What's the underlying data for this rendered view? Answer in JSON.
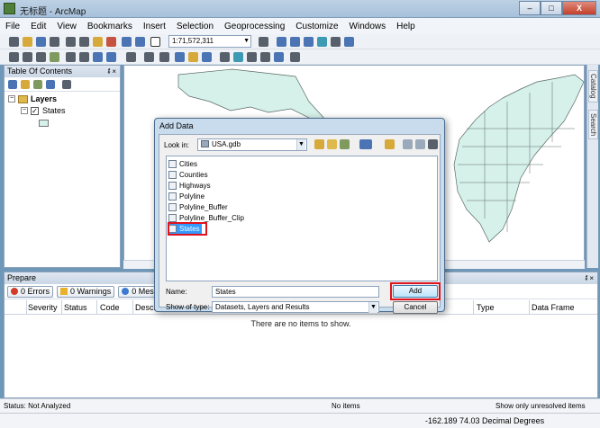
{
  "window": {
    "title": "无标题 - ArcMap",
    "buttons": {
      "minimize": "–",
      "maximize": "□",
      "close": "X"
    }
  },
  "menubar": {
    "items": [
      "File",
      "Edit",
      "View",
      "Bookmarks",
      "Insert",
      "Selection",
      "Geoprocessing",
      "Customize",
      "Windows",
      "Help"
    ]
  },
  "toolbar": {
    "scale": "1:71,572,311",
    "icons": [
      "new-document-icon",
      "open-icon",
      "save-icon",
      "print-icon",
      "cut-icon",
      "copy-icon",
      "paste-icon",
      "delete-icon",
      "undo-icon",
      "redo-icon",
      "add-data-icon",
      "zoom-in-icon",
      "zoom-out-icon",
      "pan-icon",
      "full-extent-icon",
      "identify-icon",
      "find-icon",
      "measure-icon"
    ]
  },
  "toc": {
    "title": "Table Of Contents",
    "pin": "ᵮ ×",
    "layers_label": "Layers",
    "layer_name": "States",
    "expand_symbol": "−",
    "check_symbol": "✓"
  },
  "side_tabs": {
    "catalog": "Catalog",
    "search": "Search"
  },
  "prepare": {
    "title": "Prepare",
    "pin": "ᵮ ×",
    "tabs": [
      "0 Errors",
      "0 Warnings",
      "0 Messa"
    ],
    "columns": [
      "Severity",
      "Status",
      "Code",
      "Descr",
      "Type",
      "Data Frame"
    ],
    "empty_message": "There are no items to show."
  },
  "status": {
    "left": "Status: Not Analyzed",
    "middle": "No items",
    "right": "Show only unresolved items"
  },
  "coords": {
    "value": "-162.189  74.03 Decimal Degrees"
  },
  "dialog": {
    "title": "Add Data",
    "look_in_label": "Look in:",
    "look_in_value": "USA.gdb",
    "files": [
      "Cities",
      "Counties",
      "Highways",
      "Polyline",
      "Polyline_Buffer",
      "Polyline_Buffer_Clip",
      "States"
    ],
    "selected_file": "States",
    "name_label": "Name:",
    "name_value": "States",
    "type_label": "Show of type:",
    "type_value": "Datasets, Layers and Results",
    "add_button": "Add",
    "cancel_button": "Cancel"
  },
  "colors": {
    "map_fill": "#d6f0ea",
    "map_stroke": "#5a6b66",
    "highlight_red": "#e0121d",
    "selection_blue": "#3399ff"
  }
}
